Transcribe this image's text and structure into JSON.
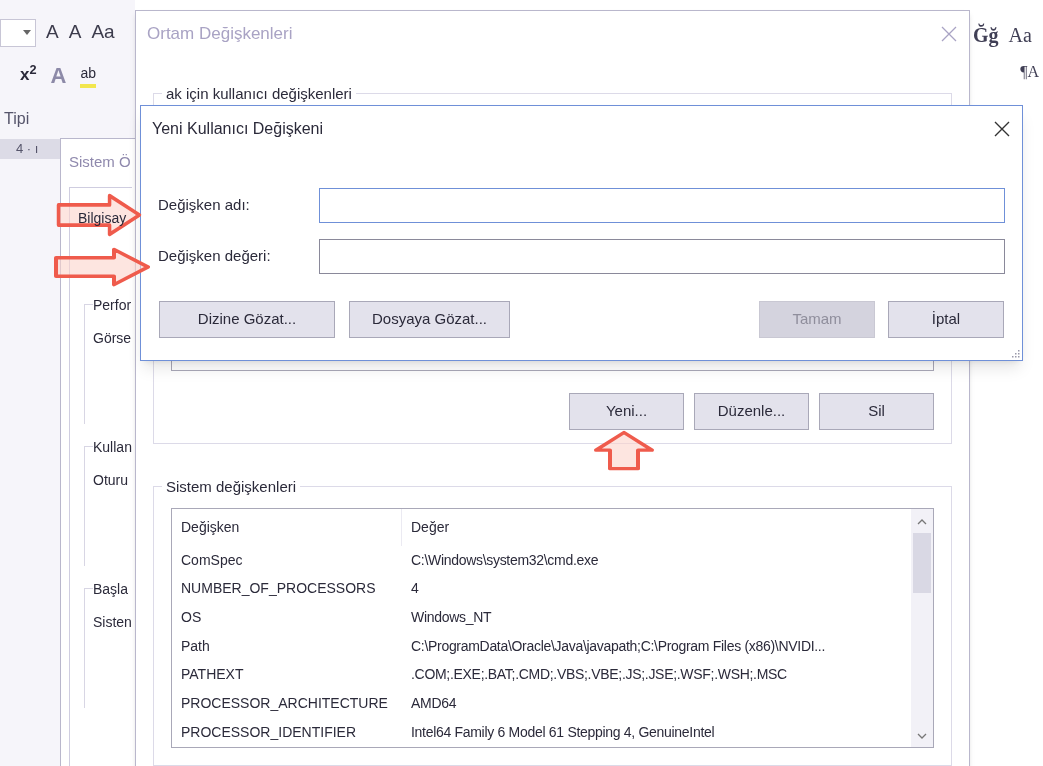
{
  "background_app": {
    "ribbon_row_1": [
      "A",
      "A",
      "Aa"
    ],
    "ribbon_row_2": [
      "x$^{2}$",
      "A",
      "ab"
    ],
    "group_label": "Tipi",
    "ruler": "4 · ı",
    "right_styles": [
      "Ğğ",
      "Aa"
    ],
    "right_row_2": "¶A"
  },
  "system_properties_window": {
    "title": "Sistem Ö",
    "tab": "Bilgisay",
    "groups": [
      {
        "title": "Perfor",
        "text": "Görse"
      },
      {
        "title": "Kullan",
        "text": "Oturu"
      },
      {
        "title": "Başla",
        "text": "Sisten"
      }
    ]
  },
  "environment_window": {
    "title": "Ortam Değişkenleri",
    "active": false,
    "user_section": {
      "label": "ak için kullanıcı değişkenleri",
      "buttons": [
        "Yeni...",
        "Düzenle...",
        "Sil"
      ]
    },
    "system_section": {
      "label": "Sistem değişkenleri",
      "columns": [
        "Değişken",
        "Değer"
      ],
      "rows": [
        {
          "name": "ComSpec",
          "value": "C:\\Windows\\system32\\cmd.exe"
        },
        {
          "name": "NUMBER_OF_PROCESSORS",
          "value": "4"
        },
        {
          "name": "OS",
          "value": "Windows_NT"
        },
        {
          "name": "Path",
          "value": "C:\\ProgramData\\Oracle\\Java\\javapath;C:\\Program Files (x86)\\NVIDI..."
        },
        {
          "name": "PATHEXT",
          "value": ".COM;.EXE;.BAT;.CMD;.VBS;.VBE;.JS;.JSE;.WSF;.WSH;.MSC"
        },
        {
          "name": "PROCESSOR_ARCHITECTURE",
          "value": "AMD64"
        },
        {
          "name": "PROCESSOR_IDENTIFIER",
          "value": "Intel64 Family 6 Model 61 Stepping 4, GenuineIntel"
        }
      ]
    }
  },
  "new_variable_dialog": {
    "title": "Yeni Kullanıcı Değişkeni",
    "active": true,
    "fields": [
      {
        "label": "Değişken adı:",
        "focused": true
      },
      {
        "label": "Değişken değeri:",
        "focused": false
      }
    ],
    "left_buttons": [
      {
        "label": "Dizine Gözat...",
        "disabled": false
      },
      {
        "label": "Dosyaya Gözat...",
        "disabled": false
      }
    ],
    "right_buttons": [
      {
        "label": "Tamam",
        "disabled": true
      },
      {
        "label": "İptal",
        "disabled": false
      }
    ]
  },
  "annotations": [
    {
      "kind": "right"
    },
    {
      "kind": "right"
    },
    {
      "kind": "up"
    }
  ]
}
